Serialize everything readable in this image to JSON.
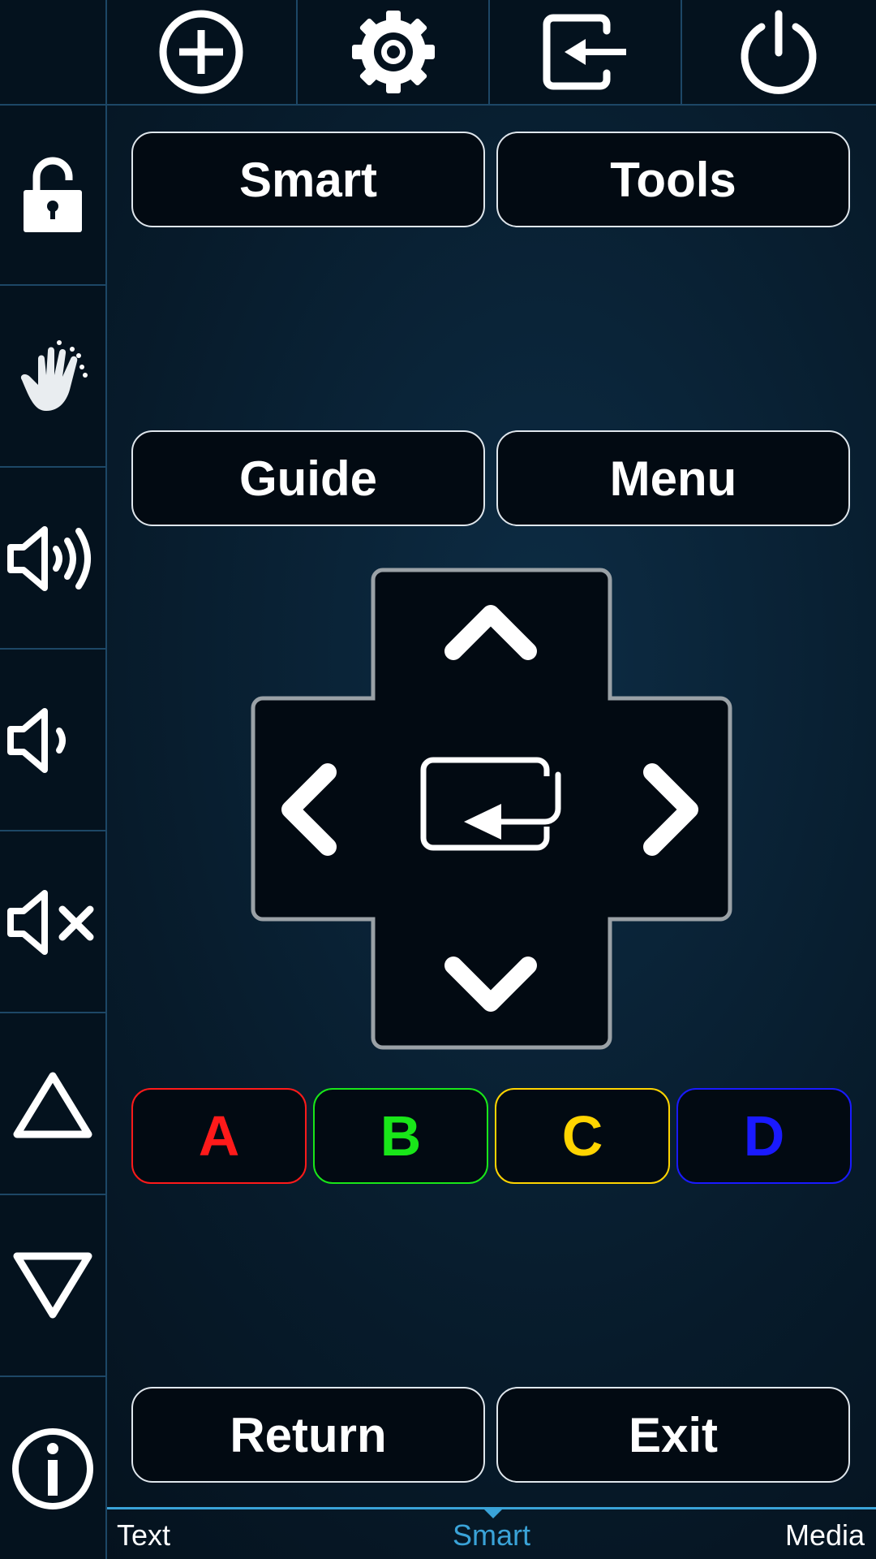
{
  "colors": {
    "accent": "#3aa3d8",
    "red": "#ff1a1a",
    "green": "#19e619",
    "yellow": "#ffd400",
    "blue": "#1a1aff"
  },
  "top_bar": {
    "icons": [
      "plus-circle-icon",
      "gear-icon",
      "input-source-icon",
      "power-icon"
    ]
  },
  "side_bar": {
    "icons": [
      "lock-icon",
      "hand-gesture-icon",
      "volume-up-icon",
      "volume-down-icon",
      "mute-icon",
      "channel-up-icon",
      "channel-down-icon",
      "info-icon"
    ]
  },
  "buttons": {
    "smart": "Smart",
    "tools": "Tools",
    "guide": "Guide",
    "menu": "Menu",
    "return": "Return",
    "exit": "Exit"
  },
  "dpad": {
    "icons": [
      "chevron-up-icon",
      "chevron-left-icon",
      "enter-icon",
      "chevron-right-icon",
      "chevron-down-icon"
    ]
  },
  "color_buttons": {
    "a": "A",
    "b": "B",
    "c": "C",
    "d": "D"
  },
  "tabs": {
    "items": [
      "Text",
      "Smart",
      "Media"
    ],
    "active": "Smart"
  }
}
